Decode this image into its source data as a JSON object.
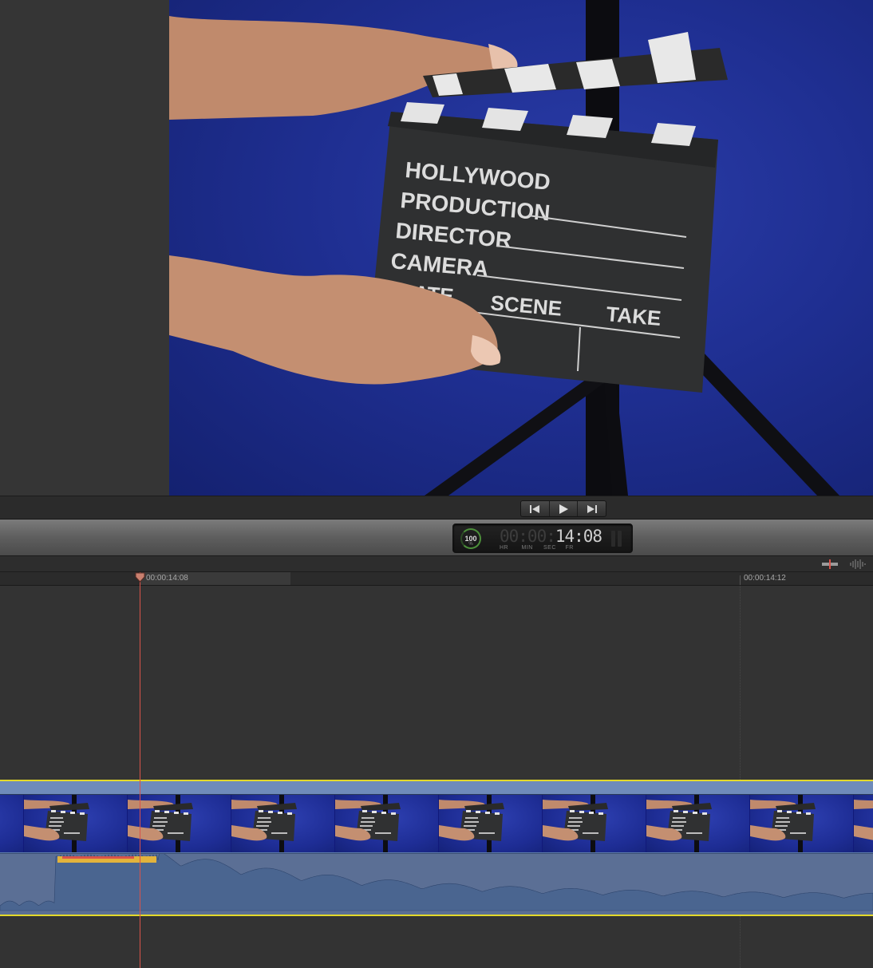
{
  "viewer": {
    "slate": {
      "line1": "HOLLYWOOD",
      "line2": "PRODUCTION",
      "line3": "DIRECTOR",
      "line4": "CAMERA",
      "col_date": "DATE",
      "col_scene": "SCENE",
      "col_take": "TAKE"
    }
  },
  "transport": {
    "prev_icon": "skip-back-icon",
    "play_icon": "play-icon",
    "next_icon": "skip-forward-icon"
  },
  "timecode": {
    "gauge_value": "100",
    "gauge_unit": "%",
    "dim_part": "00:00:",
    "lit_part": "14:08",
    "units": [
      "HR",
      "MIN",
      "SEC",
      "FR"
    ]
  },
  "toolbar": {
    "skimming_icon": "skimming-icon",
    "audio_skimming_icon": "audio-skimming-icon"
  },
  "ruler": {
    "playhead_time": "00:00:14:08",
    "end_time": "00:00:14:12"
  },
  "clip": {
    "frame_count": 9
  },
  "colors": {
    "background": "#333333",
    "clip_border": "#e4d92a",
    "clip_body": "#5c7aa8",
    "playhead": "#d9534a",
    "waveform_peak": "#e2b33c"
  }
}
